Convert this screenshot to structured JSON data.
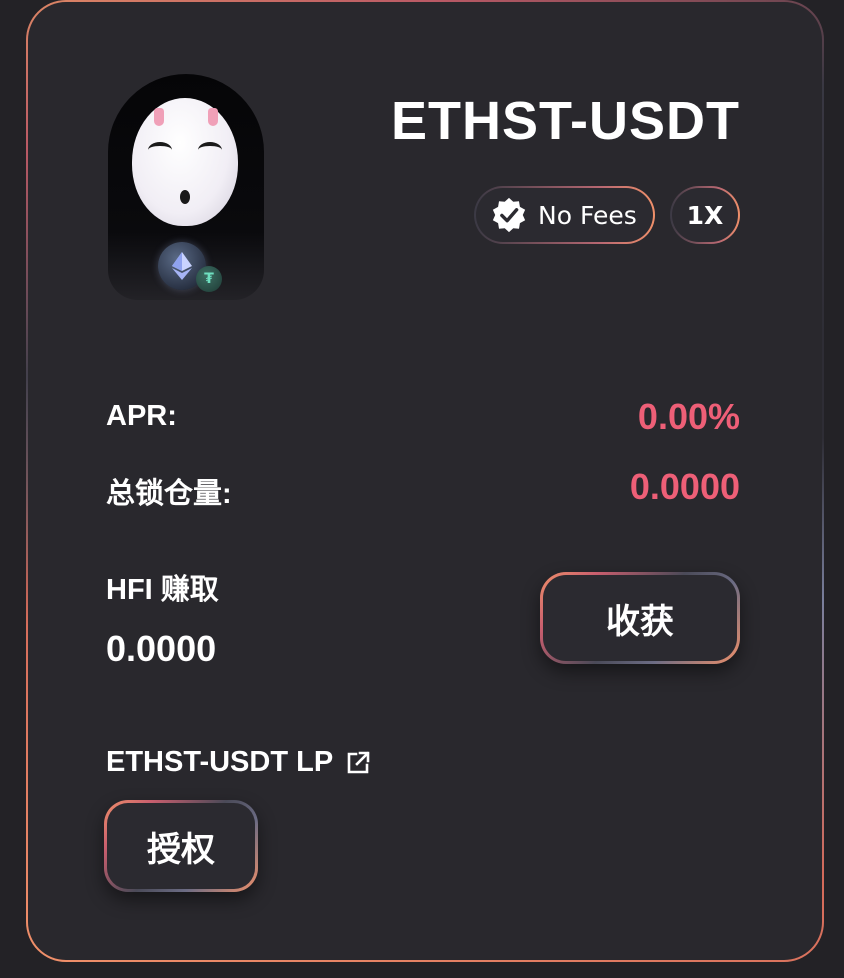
{
  "pool": {
    "title": "ETHST-USDT",
    "tags": {
      "fees": "No Fees",
      "multiplier": "1X"
    }
  },
  "stats": {
    "apr_label": "APR:",
    "apr_value": "0.00%",
    "tvl_label": "总锁仓量:",
    "tvl_value": "0.0000"
  },
  "earn": {
    "label": "HFI 赚取",
    "value": "0.0000",
    "harvest_label": "收获"
  },
  "lp": {
    "label": "ETHST-USDT LP",
    "approve_label": "授权"
  },
  "colors": {
    "accent": "#ee5f77",
    "card_bg": "#29282d",
    "gradient_orange": "#f0906a"
  },
  "icons": {
    "verified": "verified-badge-icon",
    "external": "external-link-icon",
    "eth": "ethereum-icon",
    "usdt": "tether-icon"
  }
}
